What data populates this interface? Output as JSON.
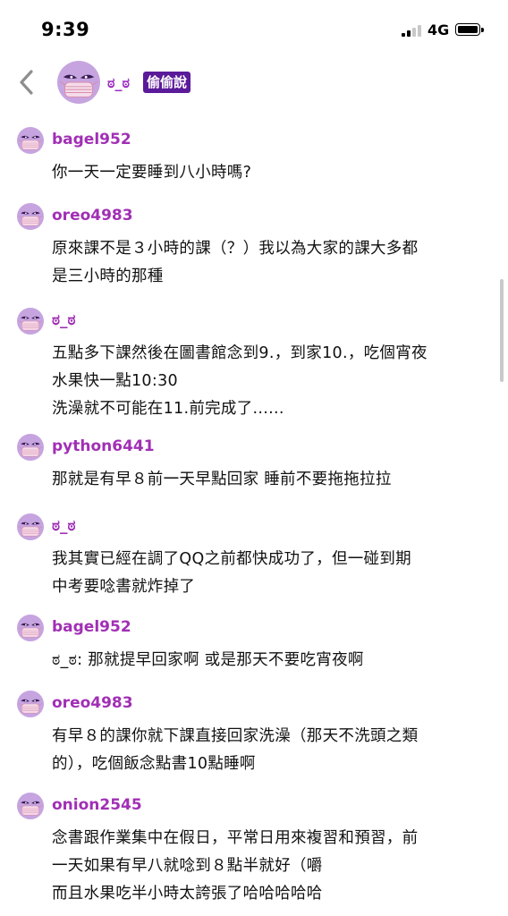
{
  "status_bar": {
    "time": "9:39",
    "network": "4G"
  },
  "header": {
    "name": "ಠ_ಠ",
    "badge": "偷偷說"
  },
  "comments": [
    {
      "user": "bagel952",
      "text": "你一天一定要睡到八小時嗎?"
    },
    {
      "user": "oreo4983",
      "text": "原來課不是３小時的課（？）我以為大家的課大多都\n是三小時的那種"
    },
    {
      "user": "ಠ_ಠ",
      "text": "五點多下課然後在圖書館念到9.，到家10.，吃個宵夜\n水果快一點10:30\n洗澡就不可能在11.前完成了......"
    },
    {
      "user": "python6441",
      "text": "那就是有早８前一天早點回家 睡前不要拖拖拉拉"
    },
    {
      "user": "ಠ_ಠ",
      "text": "我其實已經在調了QQ之前都快成功了，但一碰到期\n中考要唸書就炸掉了"
    },
    {
      "user": "bagel952",
      "text": "ಠ_ಠ: 那就提早回家啊 或是那天不要吃宵夜啊"
    },
    {
      "user": "oreo4983",
      "text": "有早８的課你就下課直接回家洗澡（那天不洗頭之類\n的），吃個飯念點書10點睡啊"
    },
    {
      "user": "onion2545",
      "text": "念書跟作業集中在假日，平常日用來複習和預習，前\n一天如果有早八就唸到８點半就好（嚼\n而且水果吃半小時太誇張了哈哈哈哈哈"
    }
  ]
}
